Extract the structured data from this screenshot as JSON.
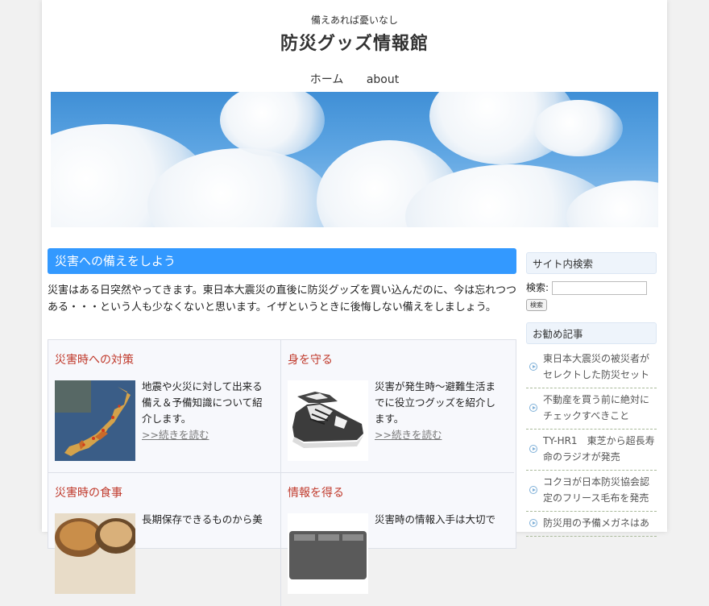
{
  "site": {
    "tagline": "備えあれば憂いなし",
    "title": "防災グッズ情報館"
  },
  "nav": {
    "items": [
      {
        "label": "ホーム"
      },
      {
        "label": "about"
      }
    ]
  },
  "main": {
    "heading": "災害への備えをしよう",
    "intro": "災害はある日突然やってきます。東日本大震災の直後に防災グッズを買い込んだのに、今は忘れつつある・・・という人も少なくないと思います。イザというときに後悔しない備えをしましょう。",
    "cards": [
      {
        "title": "災害時への対策",
        "text": "地震や火災に対して出来る備え＆予備知識について紹介します。",
        "more": ">>続きを読む"
      },
      {
        "title": "身を守る",
        "text": "災害が発生時〜避難生活までに役立つグッズを紹介します。",
        "more": ">>続きを読む"
      },
      {
        "title": "災害時の食事",
        "text": "長期保存できるものから美"
      },
      {
        "title": "情報を得る",
        "text": "災害時の情報入手は大切で"
      }
    ]
  },
  "sidebar": {
    "search_heading": "サイト内検索",
    "search_label": "検索:",
    "search_button": "検索",
    "rec_heading": "お勧め記事",
    "rec_items": [
      {
        "label": "東日本大震災の被災者がセレクトした防災セット"
      },
      {
        "label": "不動産を買う前に絶対にチェックすべきこと"
      },
      {
        "label": "TY-HR1　東芝から超長寿命のラジオが発売"
      },
      {
        "label": "コクヨが日本防災協会認定のフリース毛布を発売"
      },
      {
        "label": "防災用の予備メガネはあ"
      }
    ]
  }
}
